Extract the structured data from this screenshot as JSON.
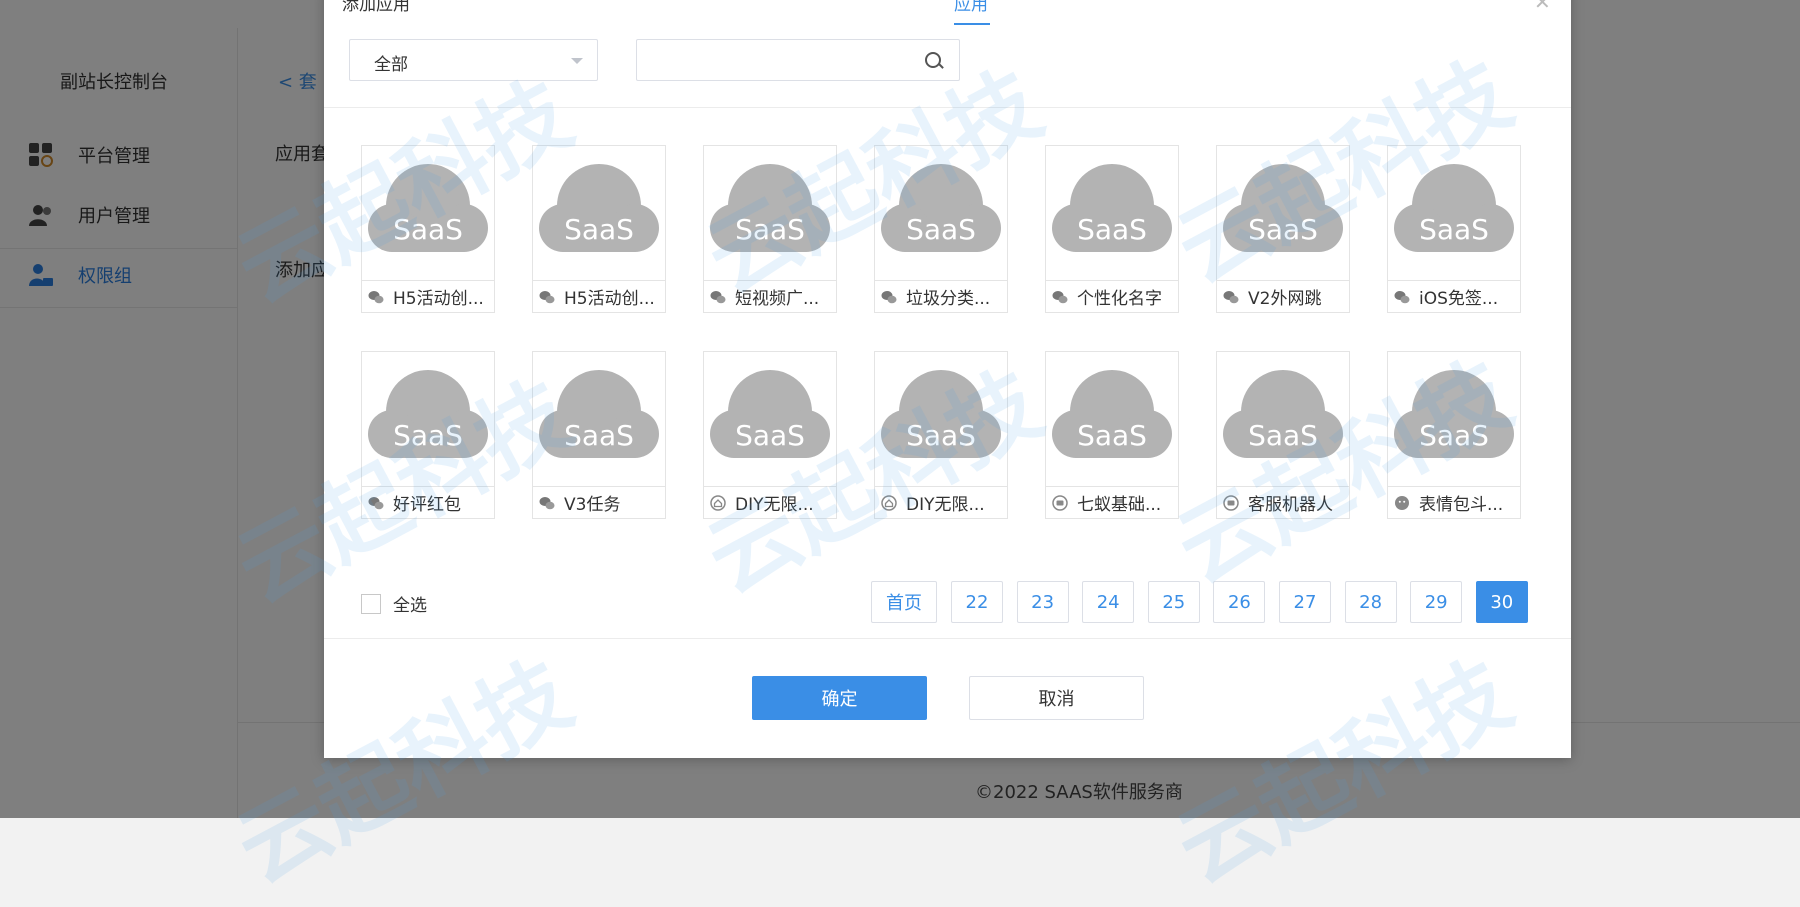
{
  "sidebar": {
    "console": "副站长控制台",
    "items": [
      {
        "label": "平台管理",
        "icon": "grid-gear-icon"
      },
      {
        "label": "用户管理",
        "icon": "users-icon"
      },
      {
        "label": "权限组",
        "icon": "user-lock-icon",
        "active": true
      }
    ]
  },
  "main": {
    "back": "< 套",
    "label1": "应用套",
    "label2": "添加应"
  },
  "footer": "©2022 SAAS软件服务商",
  "modal": {
    "title": "添加应用",
    "tab": "应用",
    "filter": {
      "value": "全部"
    },
    "search": {
      "placeholder": ""
    },
    "thumb_text": "SaaS",
    "apps": [
      {
        "name": "H5活动创...",
        "icon": "wechat-icon"
      },
      {
        "name": "H5活动创...",
        "icon": "wechat-icon"
      },
      {
        "name": "短视频广...",
        "icon": "wechat-icon"
      },
      {
        "name": "垃圾分类...",
        "icon": "wechat-icon"
      },
      {
        "name": "个性化名字",
        "icon": "wechat-icon"
      },
      {
        "name": "V2外网跳",
        "icon": "wechat-icon"
      },
      {
        "name": "iOS免签...",
        "icon": "wechat-icon"
      },
      {
        "name": "好评红包",
        "icon": "wechat-icon"
      },
      {
        "name": "V3任务",
        "icon": "wechat-icon"
      },
      {
        "name": "DIY无限...",
        "icon": "home-icon"
      },
      {
        "name": "DIY无限...",
        "icon": "home-icon"
      },
      {
        "name": "七蚁基础...",
        "icon": "chat-icon"
      },
      {
        "name": "客服机器人",
        "icon": "chat-icon"
      },
      {
        "name": "表情包斗...",
        "icon": "emoji-icon"
      }
    ],
    "select_all": "全选",
    "pagination": {
      "first": "首页",
      "pages": [
        "22",
        "23",
        "24",
        "25",
        "26",
        "27",
        "28",
        "29",
        "30"
      ],
      "current": "30"
    },
    "confirm": "确定",
    "cancel": "取消"
  },
  "colors": {
    "accent": "#3a8ee6",
    "overlay": "rgba(0,0,0,0.5)"
  }
}
